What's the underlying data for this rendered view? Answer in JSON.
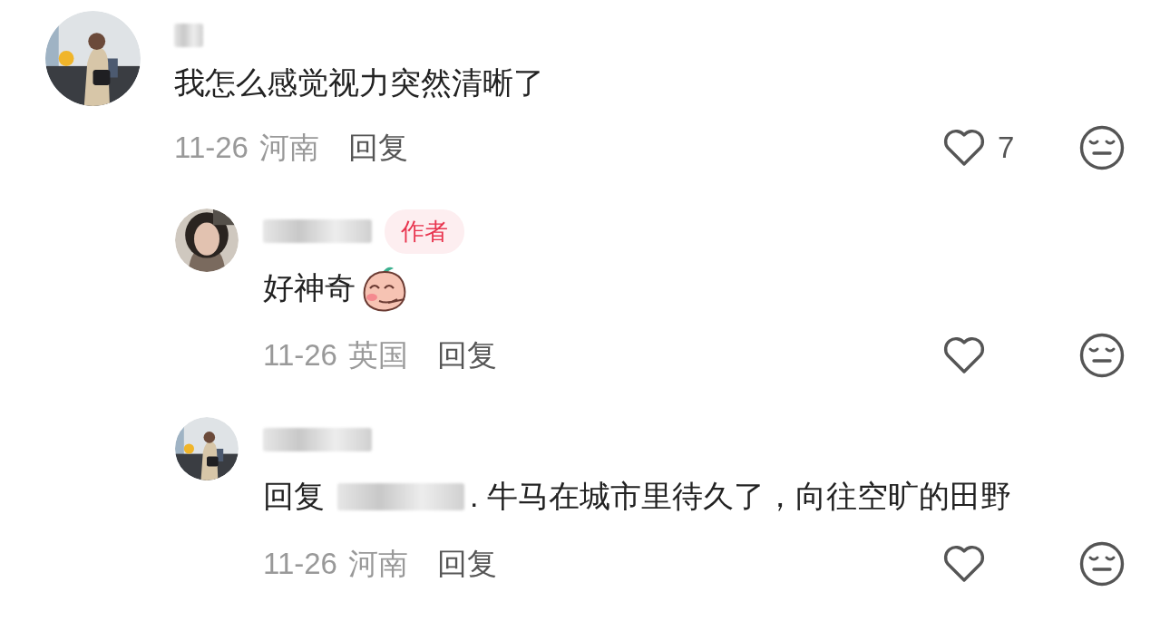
{
  "comments": [
    {
      "kind": "top",
      "name_hidden": true,
      "text": "我怎么感觉视力突然清晰了",
      "date": "11-26",
      "location": "河南",
      "reply_label": "回复",
      "likes": "7",
      "liked": false,
      "replies": [
        {
          "kind": "reply",
          "name_hidden": true,
          "badge": "作者",
          "text": "好神奇",
          "sticker": true,
          "date": "11-26",
          "location": "英国",
          "reply_label": "回复",
          "liked": false
        },
        {
          "kind": "reply",
          "name_hidden": true,
          "reply_prefix": "回复",
          "reply_to_hidden": true,
          "text": ". 牛马在城市里待久了，向往空旷的田野",
          "date": "11-26",
          "location": "河南",
          "reply_label": "回复",
          "liked": false
        }
      ]
    }
  ]
}
